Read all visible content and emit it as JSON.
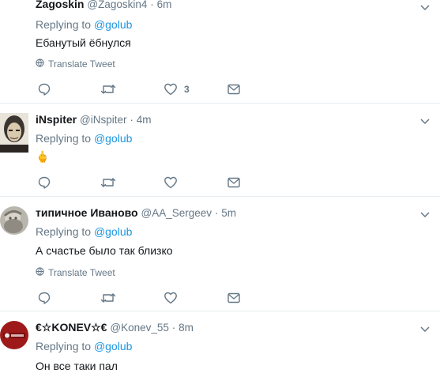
{
  "common": {
    "translate_label": "Translate Tweet"
  },
  "tweets": [
    {
      "name": "Zagoskin",
      "handle": "@Zagoskin4",
      "time": "6m",
      "reply_prefix": "Replying to",
      "reply_to": "@golub",
      "text": "Ебанутый ёбнулся",
      "like_count": "3"
    },
    {
      "name": "iNspiter",
      "handle": "@iNspiter",
      "time": "4m",
      "reply_prefix": "Replying to",
      "reply_to": "@golub",
      "text": "🖕"
    },
    {
      "name": "типичное Иваново",
      "handle": "@AA_Sergeev",
      "time": "5m",
      "reply_prefix": "Replying to",
      "reply_to": "@golub",
      "text": "А счастье было так близко"
    },
    {
      "name": "€☆KONEV☆€",
      "handle": "@Konev_55",
      "time": "8m",
      "reply_prefix": "Replying to",
      "reply_to": "@golub",
      "text": "Он все таки пал"
    }
  ],
  "icons": [
    "globe-icon",
    "reply-icon",
    "retweet-icon",
    "like-icon",
    "message-icon",
    "chevron-down-icon"
  ],
  "colors": {
    "link": "#1b95e0",
    "muted": "#657786",
    "text": "#14171a",
    "divider": "#e6ecf0"
  }
}
